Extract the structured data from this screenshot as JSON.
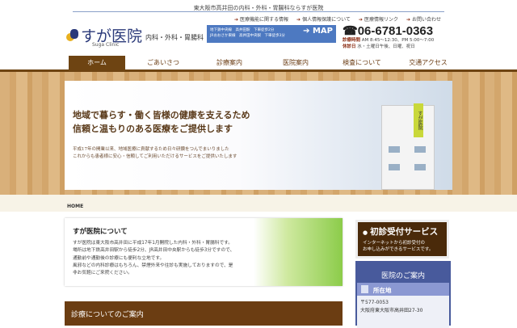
{
  "header": {
    "tagline": "東大阪市高井田の内科・外科・胃腸科ならすが医院",
    "logo_name": "すが医院",
    "logo_sub": "内科・外科・胃腸科",
    "logo_en": "Suga Clinic",
    "top_links": [
      "医療機能に関する情報",
      "個人情報保護について",
      "医療情報リンク",
      "お問い合わせ"
    ],
    "access_lines": [
      "地下鉄中央線　高井田駅　下車徒歩2分",
      "JRおおさか東線　高井田中央駅　下車徒歩3分"
    ],
    "map_label": "➔ MAP",
    "phone": "06-6781-0363",
    "hours_label": "診療時間",
    "hours": "AM 8:45〜12:30、PM 5:00〜7:00",
    "closed_label": "休診日",
    "closed": "水・土曜日午後、日曜、祝日"
  },
  "nav": [
    "ホーム",
    "ごあいさつ",
    "診療案内",
    "医院案内",
    "検査について",
    "交通アクセス"
  ],
  "hero": {
    "headline1": "地域で暮らす・働く皆様の健康を支えるため",
    "headline2": "信頼と温もりのある医療をご提供します",
    "text1": "平成17年の開業以来、地域医療に貢献するため日々研鑽をつんでまいりました",
    "text2": "これからも患者様に安心・信頼してご利用いただけるサービスをご提供いたします",
    "sign": "すが医院"
  },
  "breadcrumb": "HOME",
  "about": {
    "title": "すが医院について",
    "lines": [
      "すが医院は東大阪市高井田に平成17年1月開院した内科・外科・胃腸科です。",
      "場所は地下鉄高井田駅から徒歩2分、JR高井田中央駅からも徒歩3分ですので、",
      "通勤前や通勤後の診療にも便利な立地です。",
      "風邪などの内科診療はもちろん、禁煙外来や往診も実施しておりますので、是",
      "非お気軽にご来院ください。"
    ]
  },
  "guide_title": "診療についてのご案内",
  "sidebar": {
    "service_title": "初診受付サービス",
    "service_text1": "インターネットから初診受付の",
    "service_text2": "お申し込みができるサービスです。",
    "info_title": "医院のご案内",
    "location_label": "所在地",
    "postal": "〒577-0053",
    "address": "大阪府東大阪市高井田27-30"
  }
}
